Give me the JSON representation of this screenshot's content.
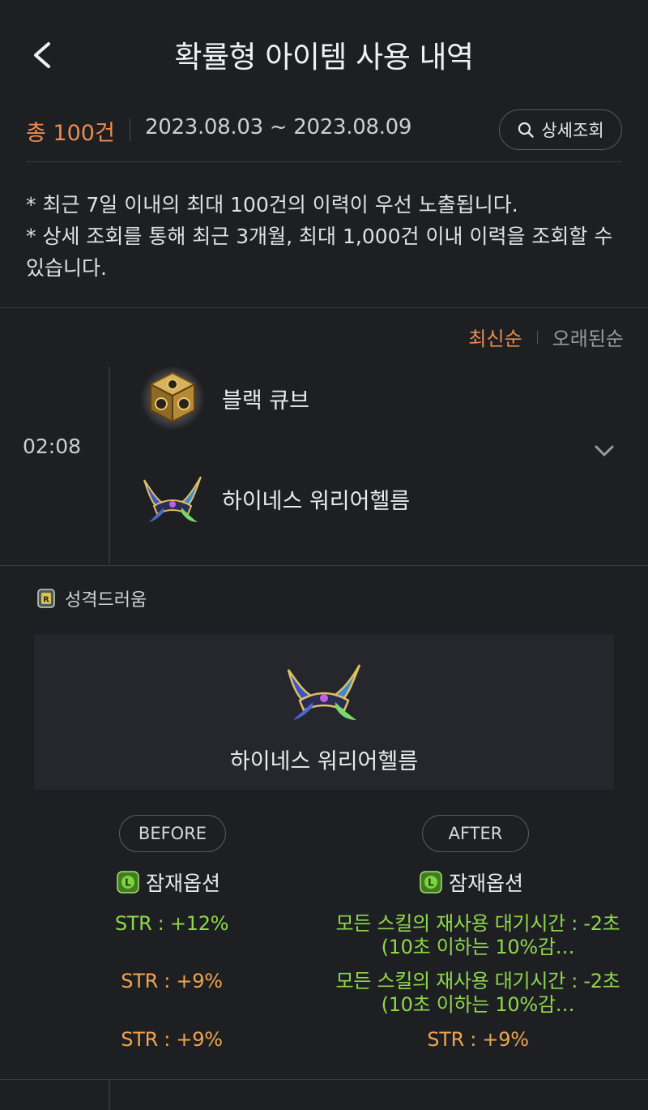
{
  "header": {
    "title": "확률형 아이템 사용 내역",
    "back_icon": "back-chevron-icon"
  },
  "summary": {
    "count": "총 100건",
    "date_range": "2023.08.03 ~ 2023.08.09",
    "detail_button": "상세조회",
    "detail_icon": "search-icon"
  },
  "notice": {
    "line1": "* 최근 7일 이내의 최대 100건의 이력이 우선 노출됩니다.",
    "line2": "* 상세 조회를 통해 최근 3개월, 최대 1,000건 이내 이력을 조회할 수 있습니다."
  },
  "sort": {
    "newest": "최신순",
    "oldest": "오래된순",
    "selected": "최신순"
  },
  "entry": {
    "time": "02:08",
    "used_item": "블랙 큐브",
    "target_item": "하이네스 워리어헬름",
    "expand_icon": "chevron-down-icon"
  },
  "detail": {
    "grade_label": "성격드러움",
    "item_name": "하이네스 워리어헬름",
    "before": {
      "label": "BEFORE",
      "potential_label": "잠재옵션",
      "options": [
        "STR : +12%",
        "STR : +9%",
        "STR : +9%"
      ]
    },
    "after": {
      "label": "AFTER",
      "potential_label": "잠재옵션",
      "options": [
        "모든 스킬의 재사용 대기시간 : -2초(10초 이하는 10%감…",
        "모든 스킬의 재사용 대기시간 : -2초(10초 이하는 10%감…",
        "STR : +9%"
      ]
    }
  },
  "colors": {
    "background": "#1e1f23",
    "accent": "#e88d4f",
    "legendary_green": "#8ed84a",
    "unique_orange": "#efa54f"
  }
}
